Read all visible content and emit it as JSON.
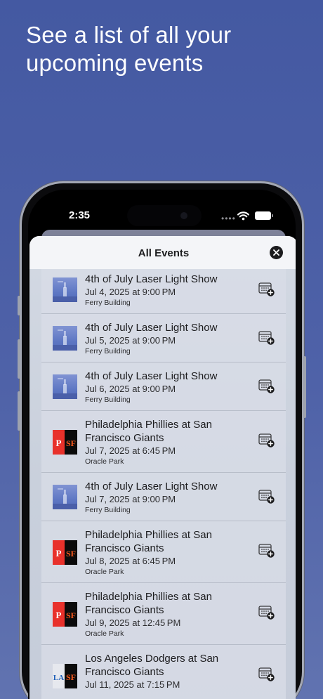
{
  "headline": "See a list of all your upcoming events",
  "status_bar": {
    "time": "2:35",
    "signal_dots": "••••"
  },
  "sheet": {
    "title": "All Events",
    "close_icon": "close-icon"
  },
  "events": [
    {
      "thumb": "laser",
      "title": "4th of July Laser Light Show",
      "date": "Jul 4, 2025 at 9:00 PM",
      "venue": "Ferry Building",
      "action_icon": "calendar-add-icon"
    },
    {
      "thumb": "laser",
      "title": "4th of July Laser Light Show",
      "date": "Jul 5, 2025 at 9:00 PM",
      "venue": "Ferry Building",
      "action_icon": "calendar-add-icon"
    },
    {
      "thumb": "laser",
      "title": "4th of July Laser Light Show",
      "date": "Jul 6, 2025 at 9:00 PM",
      "venue": "Ferry Building",
      "action_icon": "calendar-add-icon"
    },
    {
      "thumb": "phillies-giants",
      "title": "Philadelphia Phillies at San Francisco Giants",
      "date": "Jul 7, 2025 at 6:45 PM",
      "venue": "Oracle Park",
      "action_icon": "calendar-add-icon"
    },
    {
      "thumb": "laser",
      "title": "4th of July Laser Light Show",
      "date": "Jul 7, 2025 at 9:00 PM",
      "venue": "Ferry Building",
      "action_icon": "calendar-add-icon"
    },
    {
      "thumb": "phillies-giants",
      "title": "Philadelphia Phillies at San Francisco Giants",
      "date": "Jul 8, 2025 at 6:45 PM",
      "venue": "Oracle Park",
      "action_icon": "calendar-add-icon"
    },
    {
      "thumb": "phillies-giants",
      "title": "Philadelphia Phillies at San Francisco Giants",
      "date": "Jul 9, 2025 at 12:45 PM",
      "venue": "Oracle Park",
      "action_icon": "calendar-add-icon"
    },
    {
      "thumb": "dodgers-giants",
      "title": "Los Angeles Dodgers at San Francisco Giants",
      "date": "Jul 11, 2025 at 7:15 PM",
      "venue": "",
      "action_icon": "calendar-add-icon"
    }
  ],
  "colors": {
    "background": "#4a5ea5",
    "phillies_red": "#e8312b",
    "giants_black": "#0b0b0b",
    "giants_orange": "#fd5a1e",
    "dodgers_blue": "#1f5fb8"
  }
}
